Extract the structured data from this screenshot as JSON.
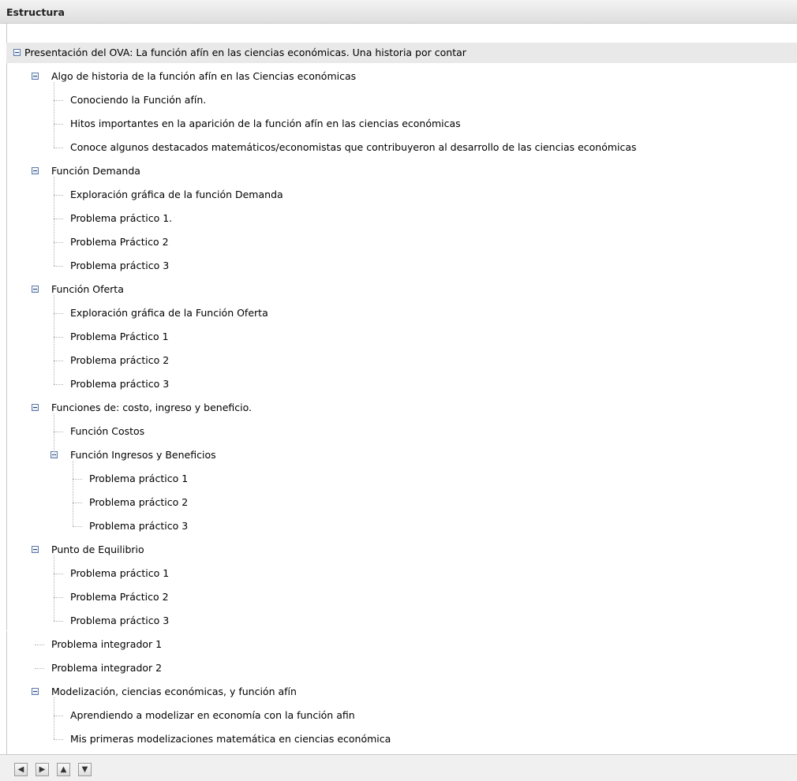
{
  "panel": {
    "title": "Estructura"
  },
  "tree": {
    "root": "Presentación del OVA: La función afín en las ciencias económicas. Una historia por contar",
    "items": [
      {
        "label": "Algo de historia de la función afín en las Ciencias económicas",
        "level": 1,
        "expanded": true
      },
      {
        "label": "Conociendo la Función afín.",
        "level": 2
      },
      {
        "label": "Hitos importantes en la aparición de la función afín en las ciencias económicas",
        "level": 2
      },
      {
        "label": "Conoce algunos destacados matemáticos/economistas que contribuyeron al desarrollo de las ciencias económicas",
        "level": 2
      },
      {
        "label": "Función Demanda",
        "level": 1,
        "expanded": true
      },
      {
        "label": "Exploración gráfica de la función Demanda",
        "level": 2
      },
      {
        "label": "Problema práctico 1.",
        "level": 2
      },
      {
        "label": "Problema Práctico 2",
        "level": 2
      },
      {
        "label": "Problema práctico 3",
        "level": 2
      },
      {
        "label": "Función Oferta",
        "level": 1,
        "expanded": true
      },
      {
        "label": "Exploración gráfica de la Función Oferta",
        "level": 2
      },
      {
        "label": "Problema Práctico 1",
        "level": 2
      },
      {
        "label": "Problema práctico 2",
        "level": 2
      },
      {
        "label": "Problema práctico 3",
        "level": 2
      },
      {
        "label": "Funciones de: costo, ingreso y beneficio.",
        "level": 1,
        "expanded": true
      },
      {
        "label": "Función Costos",
        "level": 2
      },
      {
        "label": "Función Ingresos y Beneficios",
        "level": 2,
        "expanded": true
      },
      {
        "label": "Problema práctico 1",
        "level": 3
      },
      {
        "label": "Problema práctico 2",
        "level": 3
      },
      {
        "label": "Problema práctico 3",
        "level": 3
      },
      {
        "label": "Punto de Equilibrio",
        "level": 1,
        "expanded": true
      },
      {
        "label": "Problema práctico 1",
        "level": 2
      },
      {
        "label": "Problema Práctico 2",
        "level": 2
      },
      {
        "label": "Problema práctico 3",
        "level": 2
      },
      {
        "label": "Problema integrador 1",
        "level": 1
      },
      {
        "label": "Problema integrador 2",
        "level": 1
      },
      {
        "label": "Modelización, ciencias económicas, y función afín",
        "level": 1,
        "expanded": true
      },
      {
        "label": "Aprendiendo a modelizar en economía con la función afin",
        "level": 2
      },
      {
        "label": "Mis primeras modelizaciones matemática en ciencias económica",
        "level": 2
      }
    ]
  },
  "footer": {
    "buttons": [
      {
        "name": "move-left-button",
        "icon": "arrow-left-icon",
        "glyph": "◀"
      },
      {
        "name": "move-right-button",
        "icon": "arrow-right-icon",
        "glyph": "▶"
      },
      {
        "name": "move-up-button",
        "icon": "arrow-up-icon",
        "glyph": "▲"
      },
      {
        "name": "move-down-button",
        "icon": "arrow-down-icon",
        "glyph": "▼"
      }
    ]
  }
}
